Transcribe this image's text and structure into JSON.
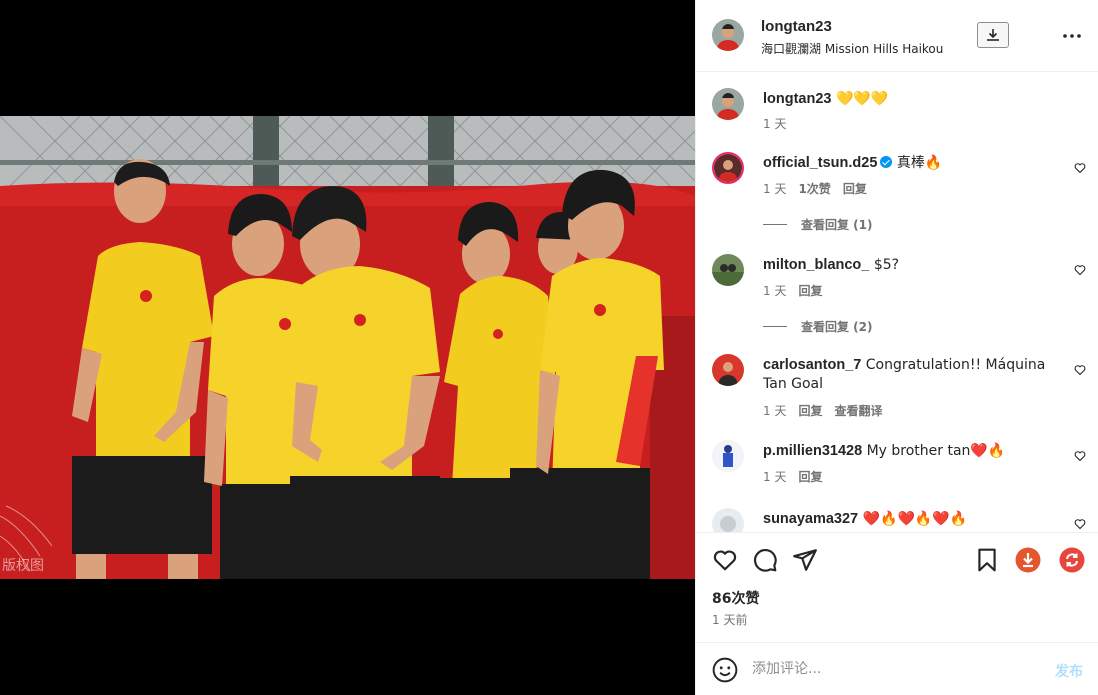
{
  "header": {
    "username": "longtan23",
    "location": "海口觀瀾湖 Mission Hills Haikou"
  },
  "media": {
    "watermark": "版权图"
  },
  "caption": {
    "username": "longtan23",
    "text": "💛💛💛",
    "time": "1 天"
  },
  "comments": [
    {
      "username": "official_tsun.d25",
      "verified": true,
      "text": "真棒🔥",
      "time": "1 天",
      "likes": "1次赞",
      "reply": "回复",
      "view_replies": "查看回复 (1)"
    },
    {
      "username": "milton_blanco_",
      "text": "$5?",
      "time": "1 天",
      "reply": "回复",
      "view_replies": "查看回复 (2)"
    },
    {
      "username": "carlosanton_7",
      "text": "Congratulation!! Máquina Tan Goal",
      "time": "1 天",
      "reply": "回复",
      "translate": "查看翻译"
    },
    {
      "username": "p.millien31428",
      "text": "My brother tan❤️🔥",
      "time": "1 天",
      "reply": "回复"
    },
    {
      "username": "sunayama327",
      "text": "❤️🔥❤️🔥❤️🔥",
      "time": "",
      "reply": ""
    }
  ],
  "actions": {
    "likes": "86次赞",
    "time": "1 天前"
  },
  "compose": {
    "placeholder": "添加评论...",
    "post_label": "发布"
  },
  "colors": {
    "accent": "#0095f6",
    "download_red": "#e4572e",
    "jersey_yellow": "#f2cd1f",
    "wall_red": "#c71f1f"
  },
  "icons": [
    "download-icon",
    "more-icon",
    "heart-icon",
    "comment-icon",
    "share-icon",
    "bookmark-icon",
    "emoji-icon",
    "verified-icon"
  ]
}
